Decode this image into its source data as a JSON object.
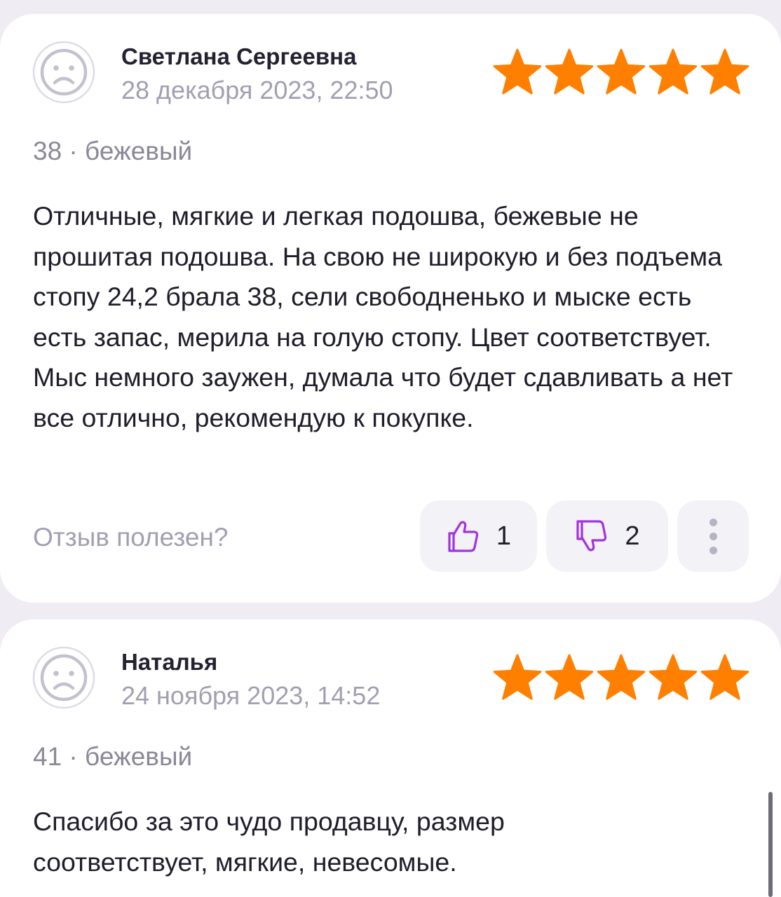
{
  "reviews": [
    {
      "author": "Светлана Сергеевна",
      "date": "28 декабря 2023, 22:50",
      "rating": 5,
      "variant": "38 · бежевый",
      "text": "Отличные, мягкие и легкая подошва, бежевые не прошитая подошва. На свою не широкую и без подъема стопу 24,2 брала 38, сели свободненько и мыске есть есть запас, мерила на голую стопу. Цвет соответствует. Мыс немного заужен, думала что будет сдавливать а нет все отлично, рекомендую к покупке.",
      "helpful_label": "Отзыв полезен?",
      "likes": "1",
      "dislikes": "2"
    },
    {
      "author": "Наталья",
      "date": "24 ноября 2023, 14:52",
      "rating": 5,
      "variant": "41 · бежевый",
      "text": "Спасибо за это чудо продавцу, размер соответствует, мягкие, невесомые."
    }
  ],
  "colors": {
    "star": "#ff8000",
    "vote_icon": "#a233e0",
    "card": "#ffffff",
    "background": "#efedf3"
  },
  "icons": [
    "avatar-placeholder-icon",
    "star-icon",
    "thumbs-up-icon",
    "thumbs-down-icon",
    "more-vertical-icon"
  ]
}
